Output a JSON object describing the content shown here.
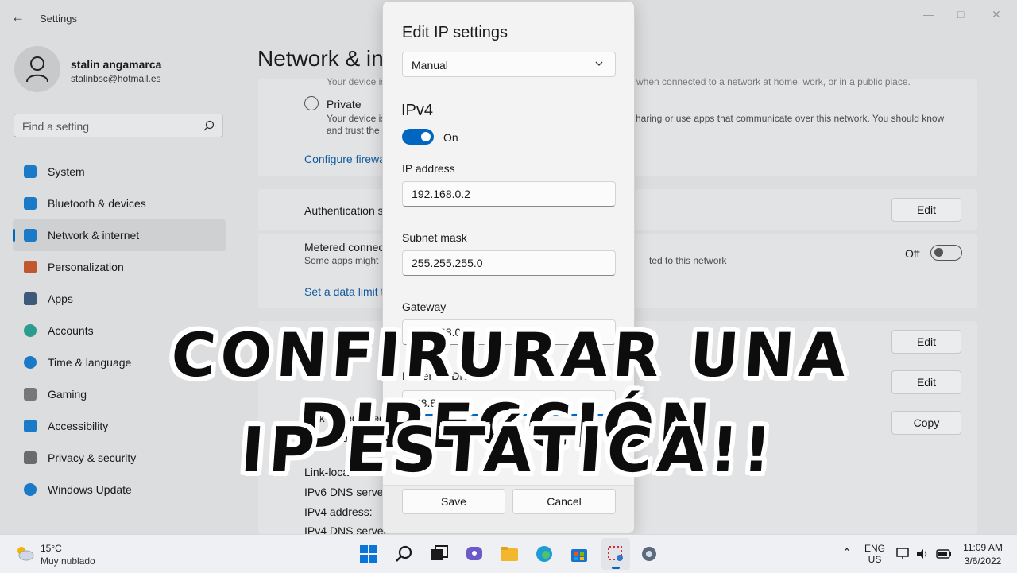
{
  "window": {
    "title": "Settings"
  },
  "user": {
    "name": "stalin angamarca",
    "email": "stalinbsc@hotmail.es"
  },
  "search": {
    "placeholder": "Find a setting"
  },
  "nav": [
    {
      "label": "System",
      "icon": "monitor-icon",
      "color": "#1b7ac7"
    },
    {
      "label": "Bluetooth & devices",
      "icon": "bluetooth-icon",
      "color": "#1b7ac7"
    },
    {
      "label": "Network & internet",
      "icon": "wifi-icon",
      "color": "#1b7ac7",
      "selected": true
    },
    {
      "label": "Personalization",
      "icon": "brush-icon",
      "color": "#c0572e"
    },
    {
      "label": "Apps",
      "icon": "apps-icon",
      "color": "#3d5a7a"
    },
    {
      "label": "Accounts",
      "icon": "person-icon",
      "color": "#2a9d8f"
    },
    {
      "label": "Time & language",
      "icon": "globe-clock-icon",
      "color": "#1b7ac7"
    },
    {
      "label": "Gaming",
      "icon": "gamepad-icon",
      "color": "#777777"
    },
    {
      "label": "Accessibility",
      "icon": "accessibility-icon",
      "color": "#1b7ac7"
    },
    {
      "label": "Privacy & security",
      "icon": "shield-icon",
      "color": "#6b6b6b"
    },
    {
      "label": "Windows Update",
      "icon": "update-icon",
      "color": "#1b7ac7"
    }
  ],
  "page": {
    "heading": "Network & in",
    "public_desc": "Your device is",
    "public_desc_right": "when connected to a network at home, work, or in a public place.",
    "private_label": "Private",
    "private_desc1": "Your device is",
    "private_desc1_right": "haring or use apps that communicate over this network. You should know",
    "private_desc2": "and trust the",
    "firewall_link": "Configure firewa",
    "auth_label": "Authentication s",
    "edit_label": "Edit",
    "metered_label": "Metered connec",
    "metered_desc": "Some apps might",
    "metered_desc_right": "ted to this network",
    "metered_state": "Off",
    "data_limit_link": "Set a data limit t",
    "ip_assign_partial": "IP assignment",
    "dns_assign_partial": "DNS server assignme",
    "link_speed": "Link speed (Rece",
    "ipv6_addr": "IPv6 addre",
    "copy_label": "Copy",
    "link_local": "Link-local",
    "ipv6_dns": "IPv6 DNS server",
    "ipv4_addr": "IPv4 address:",
    "ipv4_dns": "IPv4 DNS servers"
  },
  "dialog": {
    "title": "Edit IP settings",
    "mode": "Manual",
    "ipv4_header": "IPv4",
    "ipv4_toggle": "On",
    "ip_label": "IP address",
    "ip_value": "192.168.0.2",
    "subnet_label": "Subnet mask",
    "subnet_value": "255.255.255.0",
    "gateway_label": "Gateway",
    "gateway_value": "192.168.0.1",
    "dns_label": "Preferred DNS",
    "dns_value": "8.8.8.8",
    "alt_dns_label": "Prefer",
    "save": "Save",
    "cancel": "Cancel"
  },
  "overlay": {
    "line1": "CONFIRURAR UNA DIRECCIÓN",
    "line2": "IP ESTÁTICA!!"
  },
  "taskbar": {
    "temp": "15°C",
    "weather": "Muy nublado",
    "lang1": "ENG",
    "lang2": "US",
    "time": "11:09 AM",
    "date": "3/6/2022"
  }
}
